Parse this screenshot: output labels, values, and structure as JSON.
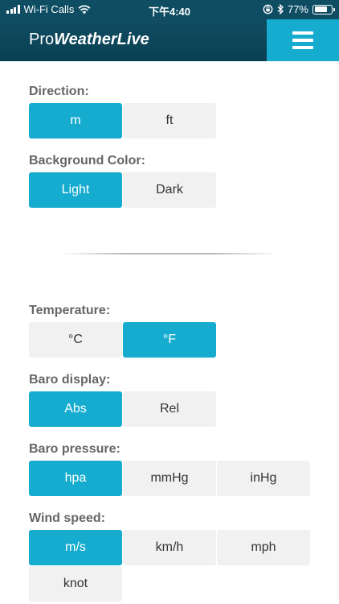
{
  "status_bar": {
    "carrier": "Wi-Fi Calls",
    "time": "下午4:40",
    "battery": "77%",
    "battery_level": 0.77,
    "icons": [
      "signal-icon",
      "wifi-icon",
      "rotation-lock-icon",
      "bluetooth-icon",
      "battery-icon"
    ]
  },
  "header": {
    "brand_pro": "Pro",
    "brand_rest": "WeatherLive",
    "menu_icon": "hamburger-menu-icon"
  },
  "colors": {
    "accent": "#16acd0",
    "header_bg": "#0f4d63",
    "option_off_bg": "#f1f1f1",
    "label": "#666666"
  },
  "settings": {
    "direction": {
      "label": "Direction:",
      "options": [
        "m",
        "ft"
      ],
      "selected": "m"
    },
    "background_color": {
      "label": "Background Color:",
      "options": [
        "Light",
        "Dark"
      ],
      "selected": "Light"
    },
    "temperature": {
      "label": "Temperature:",
      "options": [
        "°C",
        "°F"
      ],
      "selected": "°F"
    },
    "baro_display": {
      "label": "Baro display:",
      "options": [
        "Abs",
        "Rel"
      ],
      "selected": "Abs"
    },
    "baro_pressure": {
      "label": "Baro pressure:",
      "options": [
        "hpa",
        "mmHg",
        "inHg"
      ],
      "selected": "hpa"
    },
    "wind_speed": {
      "label": "Wind speed:",
      "options": [
        "m/s",
        "km/h",
        "mph",
        "knot"
      ],
      "selected": "m/s"
    }
  }
}
